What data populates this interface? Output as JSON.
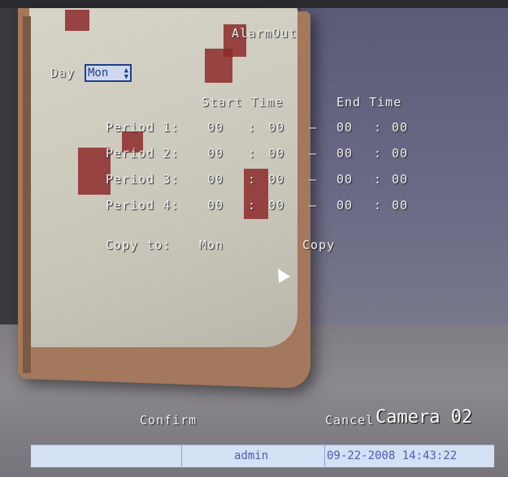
{
  "title": "AlarmOut",
  "day": {
    "label": "Day",
    "value": "Mon"
  },
  "columns": {
    "start": "Start Time",
    "end": "End Time"
  },
  "periods": [
    {
      "label": "Period 1:",
      "start_h": "00",
      "sep1": ":",
      "start_m": "00",
      "dash": "—",
      "end_h": "00",
      "sep2": ":",
      "end_m": "00"
    },
    {
      "label": "Period 2:",
      "start_h": "00",
      "sep1": ":",
      "start_m": "00",
      "dash": "—",
      "end_h": "00",
      "sep2": ":",
      "end_m": "00"
    },
    {
      "label": "Period 3:",
      "start_h": "00",
      "sep1": ":",
      "start_m": "00",
      "dash": "—",
      "end_h": "00",
      "sep2": ":",
      "end_m": "00"
    },
    {
      "label": "Period 4:",
      "start_h": "00",
      "sep1": ":",
      "start_m": "00",
      "dash": "—",
      "end_h": "00",
      "sep2": ":",
      "end_m": "00"
    }
  ],
  "copy": {
    "label": "Copy to:",
    "value": "Mon",
    "button": "Copy"
  },
  "actions": {
    "confirm": "Confirm",
    "cancel": "Cancel"
  },
  "camera": "Camera 02",
  "status": {
    "user": "admin",
    "datetime": "09-22-2008 14:43:22"
  }
}
